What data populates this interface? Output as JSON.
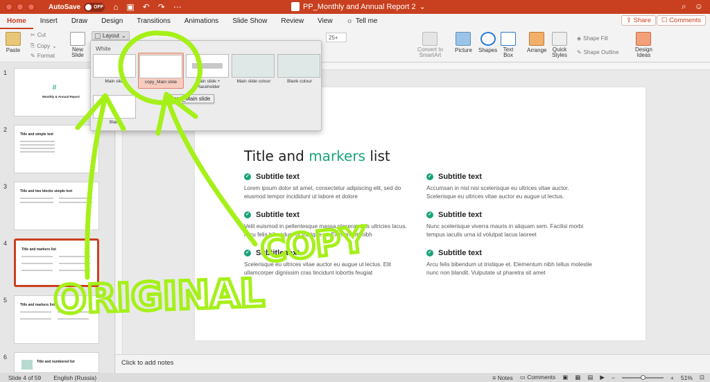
{
  "titlebar": {
    "autosave": "AutoSave",
    "toggle": "OFF",
    "doc_title": "PP_Monthly and Annual Report 2"
  },
  "tabs": [
    "Home",
    "Insert",
    "Draw",
    "Design",
    "Transitions",
    "Animations",
    "Slide Show",
    "Review",
    "View"
  ],
  "tell_me": "Tell me",
  "share": "Share",
  "comments": "Comments",
  "ribbon": {
    "paste": "Paste",
    "cut": "Cut",
    "copy": "Copy",
    "format": "Format",
    "new_slide": "New\nSlide",
    "layout": "Layout",
    "font_size": "25+",
    "convert": "Convert to\nSmartArt",
    "picture": "Picture",
    "shapes": "Shapes",
    "textbox": "Text\nBox",
    "arrange": "Arrange",
    "quick_styles": "Quick\nStyles",
    "shape_fill": "Shape Fill",
    "shape_outline": "Shape Outline",
    "design_ideas": "Design\nIdeas"
  },
  "layout_dropdown": {
    "header": "White",
    "items": [
      {
        "label": "Main slide"
      },
      {
        "label": "copy_Main slide"
      },
      {
        "label": "Main slide +\nPlaceholder"
      },
      {
        "label": "Main slide colour"
      },
      {
        "label": "Blank colour"
      },
      {
        "label": "Blank"
      }
    ],
    "tooltip": "copy_Main slide"
  },
  "thumbnails": [
    {
      "num": "1",
      "title": "Monthly & Annual Report"
    },
    {
      "num": "2",
      "title": "Title and simple text"
    },
    {
      "num": "3",
      "title": "Title and two blocks simple text"
    },
    {
      "num": "4",
      "title": "Title and markers list"
    },
    {
      "num": "5",
      "title": "Title and markers list"
    },
    {
      "num": "6",
      "title": "Title and numbered list"
    }
  ],
  "slide": {
    "title_pre": "Title and ",
    "title_accent": "markers",
    "title_post": " list",
    "items": [
      {
        "head": "Subtitle text",
        "body": "Lorem ipsum dolor sit amet, consectetur adipiscing elit, sed do eiusmod tempor incididunt ut labore et dolore"
      },
      {
        "head": "Subtitle text",
        "body": "Accumsan in nisl nisi scelerisque eu ultrices vitae auctor. Scelerisque eu ultrices vitae auctor eu augue ut lectus."
      },
      {
        "head": "Subtitle text",
        "body": "Velit euismod in pellentesque massa placerat duis ultricies lacus. Arcu felis bibendum ut tristique et. Elementum nibh"
      },
      {
        "head": "Subtitle text",
        "body": "Nunc scelerisque viverra mauris in aliquam sem. Facilisi morbi tempus iaculis urna id volutpat lacus laoreet"
      },
      {
        "head": "Subtitle text",
        "body": "Scelerisque eu ultrices vitae auctor eu augue ut lectus. Elit ullamcorper dignissim cras tincidunt lobortis feugiat"
      },
      {
        "head": "Subtitle text",
        "body": "Arcu felis bibendum ut tristique et. Elementum nibh tellus molestie nunc non blandit. Vulputate ut pharetra sit amet"
      }
    ]
  },
  "notes_placeholder": "Click to add notes",
  "status": {
    "slide_info": "Slide 4 of 59",
    "language": "English (Russia)",
    "notes": "Notes",
    "comments": "Comments",
    "zoom": "51%",
    "zoom_level": 0.51
  },
  "annotations": {
    "original": "ORIGINAL",
    "copy": "COPY",
    "color": "#a6f01a"
  },
  "colors": {
    "accent": "#c8401f",
    "slide_accent": "#1aa37a"
  }
}
